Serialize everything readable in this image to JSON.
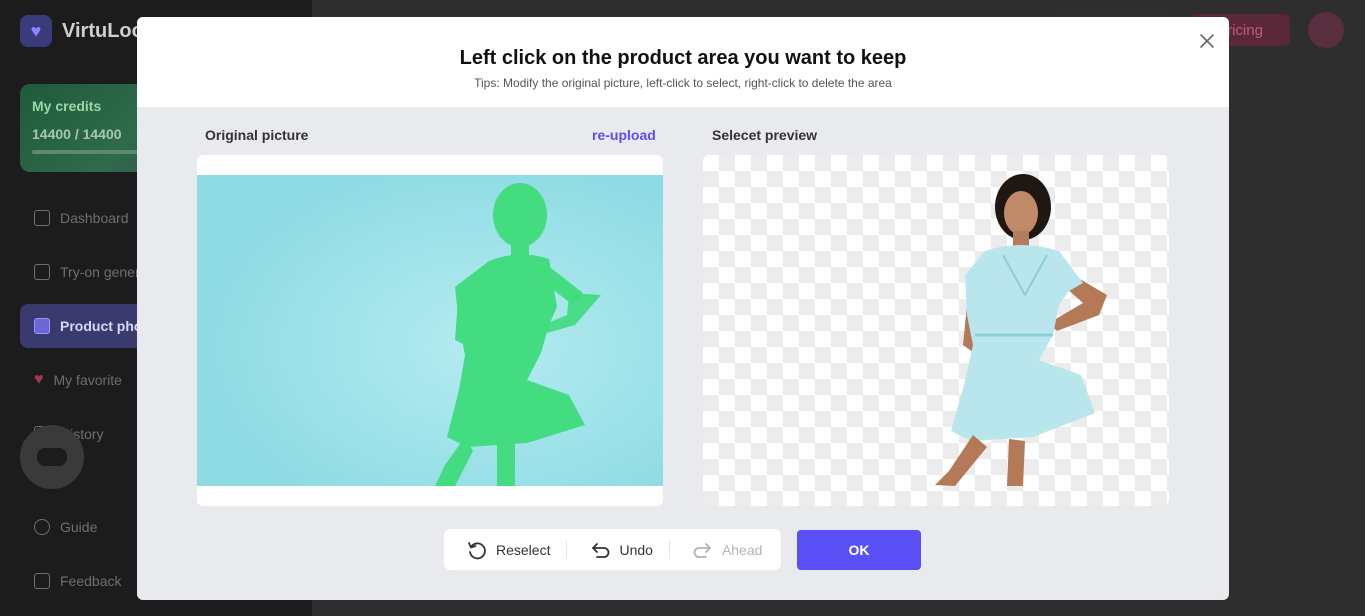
{
  "app": {
    "brand": "VirtuLoo",
    "credits_label": "My credits",
    "credits_value": "14400 / 14400",
    "pricing_label": "Pricing",
    "nav": [
      {
        "label": "Dashboard"
      },
      {
        "label": "Try-on generator"
      },
      {
        "label": "Product photo"
      },
      {
        "label": "My favorite"
      },
      {
        "label": "History"
      },
      {
        "label": "Guide"
      },
      {
        "label": "Feedback"
      }
    ]
  },
  "modal": {
    "title": "Left click on the product area you want to keep",
    "tips": "Tips: Modify the original picture, left-click to select, right-click to delete the area",
    "original_label": "Original picture",
    "reupload_label": "re-upload",
    "preview_label": "Selecet preview",
    "toolbar": {
      "reselect": "Reselect",
      "undo": "Undo",
      "ahead": "Ahead"
    },
    "ok_label": "OK"
  },
  "colors": {
    "accent": "#5a4ff5",
    "mask": "#35e07a",
    "photo_bg": "#9be1e9"
  }
}
